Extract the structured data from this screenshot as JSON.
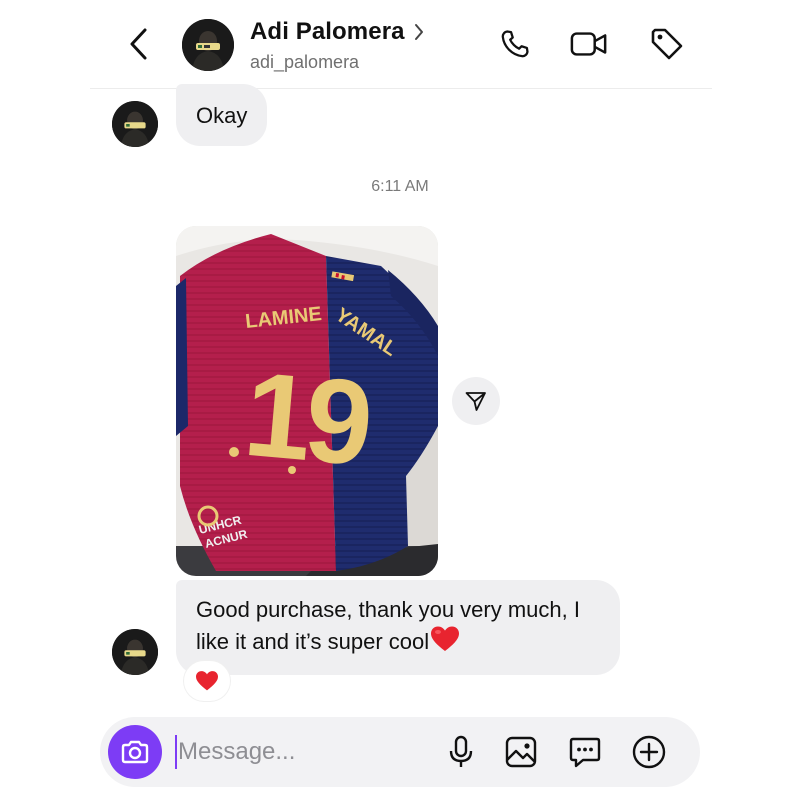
{
  "header": {
    "name": "Adi Palomera",
    "username": "adi_palomera",
    "icons": [
      "back-icon",
      "chevron-right-icon",
      "phone-icon",
      "video-icon",
      "tag-icon"
    ]
  },
  "thread": {
    "messages": [
      {
        "sender": "Adi Palomera",
        "text": "Okay"
      },
      {
        "type": "timestamp",
        "text": "6:11 AM"
      },
      {
        "type": "photo",
        "jersey_name": "LAMINE YAMAL",
        "jersey_number": "19",
        "sponsor": "UNHCR ACNUR"
      },
      {
        "sender": "Adi Palomera",
        "text": "Good purchase, thank you very much, I like it and it’s super cool",
        "emoji": "red-heart",
        "reaction": "red-heart"
      }
    ]
  },
  "composer": {
    "placeholder": "Message...",
    "icons": [
      "camera-icon",
      "microphone-icon",
      "gallery-icon",
      "sticker-icon",
      "plus-icon"
    ]
  },
  "colors": {
    "accent": "#7d3cf5",
    "bubble": "#efeff1",
    "heart": "#e8242f",
    "jersey_red": "#b0204a",
    "jersey_blue": "#1d2a6b",
    "jersey_gold": "#e9c975"
  }
}
